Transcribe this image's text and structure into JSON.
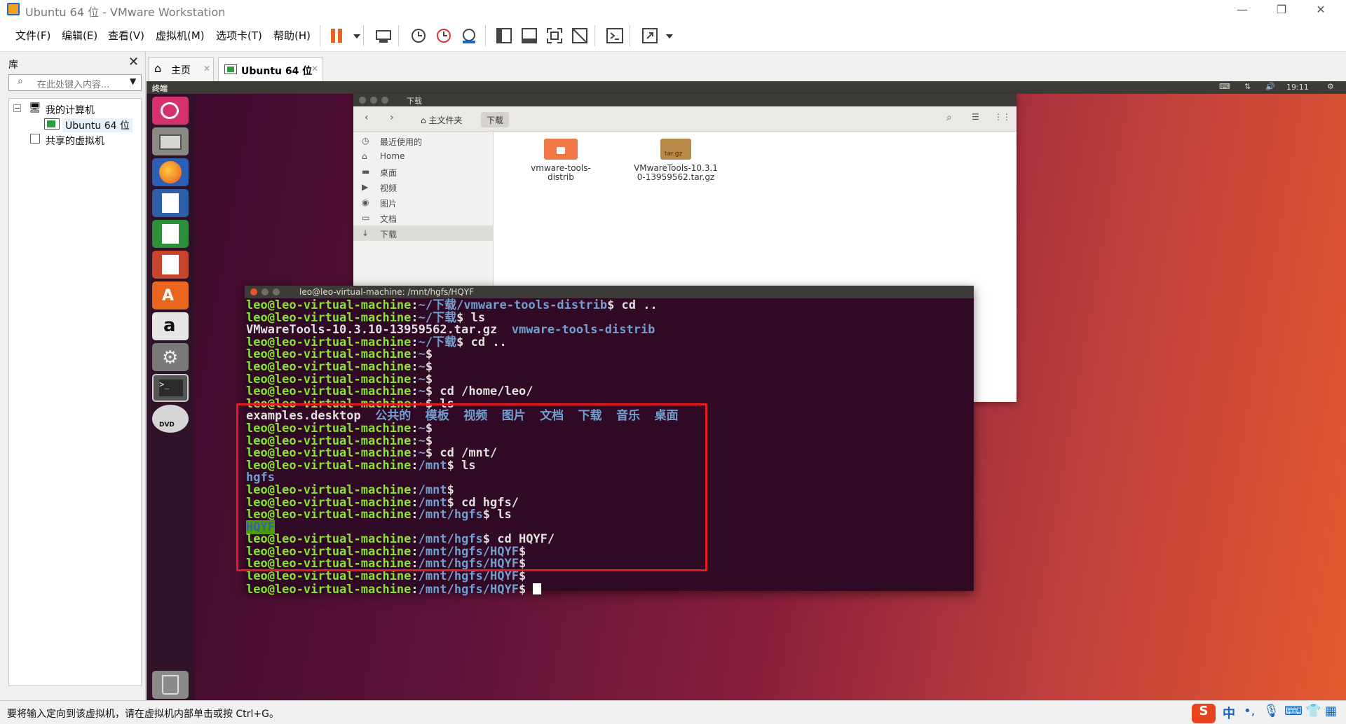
{
  "window": {
    "title": "Ubuntu 64 位 - VMware Workstation"
  },
  "menu": [
    "文件(F)",
    "编辑(E)",
    "查看(V)",
    "虚拟机(M)",
    "选项卡(T)",
    "帮助(H)"
  ],
  "library": {
    "title": "库",
    "search_placeholder": "在此处键入内容...",
    "tree": {
      "my_computer": "我的计算机",
      "vm": "Ubuntu 64 位",
      "shared": "共享的虚拟机"
    }
  },
  "tabs": {
    "home": "主页",
    "vm": "Ubuntu 64 位"
  },
  "guest": {
    "topbar": {
      "app": "终端",
      "time": "19:11"
    },
    "file_manager": {
      "title": "下载",
      "breadcrumbs": [
        "主文件夹",
        "下载"
      ],
      "sidebar": [
        "最近使用的",
        "Home",
        "桌面",
        "视频",
        "图片",
        "文档",
        "下载"
      ],
      "files": [
        {
          "name": "vmware-tools-distrib",
          "icon": "folder-icon"
        },
        {
          "name": "VMwareTools-10.3.10-13959562.tar.gz",
          "icon": "archive-icon",
          "badge": "tar.gz"
        }
      ]
    },
    "terminal": {
      "title": "leo@leo-virtual-machine: /mnt/hgfs/HQYF",
      "user": "leo@leo-virtual-machine",
      "lines": [
        {
          "path": "~/下载/vmware-tools-distrib",
          "cmd": "cd .."
        },
        {
          "path": "~/下载",
          "cmd": "ls"
        },
        {
          "out": [
            "VMwareTools-10.3.10-13959562.tar.gz",
            "vmware-tools-distrib"
          ]
        },
        {
          "path": "~/下载",
          "cmd": "cd .."
        },
        {
          "path": "~",
          "cmd": ""
        },
        {
          "path": "~",
          "cmd": ""
        },
        {
          "path": "~",
          "cmd": ""
        },
        {
          "path": "~",
          "cmd": "cd /home/leo/"
        },
        {
          "path": "~",
          "cmd": "ls"
        },
        {
          "out": [
            "examples.desktop",
            "公共的",
            "模板",
            "视频",
            "图片",
            "文档",
            "下载",
            "音乐",
            "桌面"
          ]
        },
        {
          "path": "~",
          "cmd": ""
        },
        {
          "path": "~",
          "cmd": ""
        },
        {
          "path": "~",
          "cmd": "cd /mnt/"
        },
        {
          "path": "/mnt",
          "cmd": "ls"
        },
        {
          "out": [
            "hgfs"
          ]
        },
        {
          "path": "/mnt",
          "cmd": ""
        },
        {
          "path": "/mnt",
          "cmd": "cd hgfs/"
        },
        {
          "path": "/mnt/hgfs",
          "cmd": "ls"
        },
        {
          "out": [
            "HQYF"
          ],
          "highlight": true
        },
        {
          "path": "/mnt/hgfs",
          "cmd": "cd HQYF/"
        },
        {
          "path": "/mnt/hgfs/HQYF",
          "cmd": ""
        },
        {
          "path": "/mnt/hgfs/HQYF",
          "cmd": ""
        },
        {
          "path": "/mnt/hgfs/HQYF",
          "cmd": ""
        },
        {
          "path": "/mnt/hgfs/HQYF",
          "cmd": "",
          "cursor": true
        }
      ]
    }
  },
  "status": {
    "message": "要将输入定向到该虚拟机，请在虚拟机内部单击或按 Ctrl+G。"
  },
  "ime": {
    "lang": "中"
  },
  "colors": {
    "prompt_user": "#8ae234",
    "prompt_path": "#729fcf",
    "terminal_bg": "#300a24",
    "highlight_box": "#e31b23"
  }
}
